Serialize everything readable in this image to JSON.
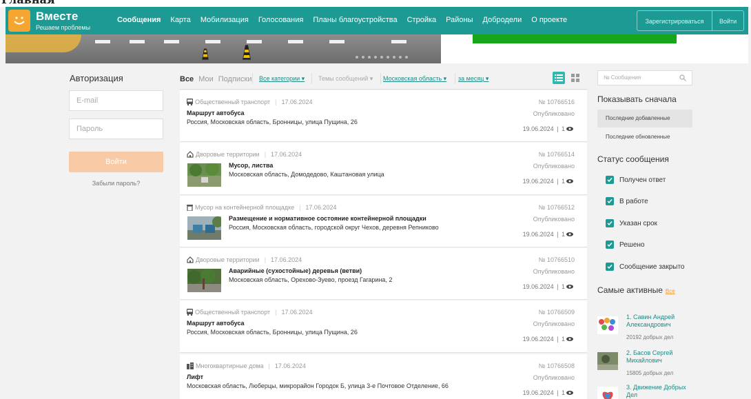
{
  "top_crop_text": "Главная",
  "header": {
    "brand": "Вместе",
    "tagline": "Решаем проблемы",
    "nav": [
      "Сообщения",
      "Карта",
      "Мобилизация",
      "Голосования",
      "Планы благоустройства",
      "Стройка",
      "Районы",
      "Добродели",
      "О проекте"
    ],
    "register": "Зарегистрироваться",
    "login": "Войти"
  },
  "auth": {
    "title": "Авторизация",
    "email_placeholder": "E-mail",
    "password_placeholder": "Пароль",
    "submit": "Войти",
    "forgot": "Забыли пароль?"
  },
  "feed": {
    "tabs": [
      "Все",
      "Мои",
      "Подписки"
    ],
    "filters": {
      "category": "Все категории",
      "topics": "Темы сообщений",
      "region": "Московская область",
      "period": "за месяц"
    },
    "cards": [
      {
        "category": "Общественный транспорт",
        "date": "17.06.2024",
        "title": "Маршрут автобуса",
        "address": "Россия, Московская область, Бронницы, улица Пущина, 26",
        "number": "№ 10766516",
        "status": "Опубликовано",
        "updated": "19.06.2024",
        "views": "1",
        "icon": "bus-icon",
        "thumb": false
      },
      {
        "category": "Дворовые территории",
        "date": "17.06.2024",
        "title": "Мусор, листва",
        "address": "Московская область, Домодедово, Каштановая улица",
        "number": "№ 10766514",
        "status": "Опубликовано",
        "updated": "19.06.2024",
        "views": "1",
        "icon": "house-icon",
        "thumb": true
      },
      {
        "category": "Мусор на контейнерной площадке",
        "date": "17.06.2024",
        "title": "Размещение и нормативное состояние контейнерной площадки",
        "address": "Россия, Московская область, городской округ Чехов, деревня Репниково",
        "number": "№ 10766512",
        "status": "Опубликовано",
        "updated": "19.06.2024",
        "views": "1",
        "icon": "trash-icon",
        "thumb": true
      },
      {
        "category": "Дворовые территории",
        "date": "17.06.2024",
        "title": "Аварийные (сухостойные) деревья (ветви)",
        "address": "Московская область, Орехово-Зуево, проезд Гагарина, 2",
        "number": "№ 10766510",
        "status": "Опубликовано",
        "updated": "19.06.2024",
        "views": "1",
        "icon": "house-icon",
        "thumb": true
      },
      {
        "category": "Общественный транспорт",
        "date": "17.06.2024",
        "title": "Маршрут автобуса",
        "address": "Россия, Московская область, Бронницы, улица Пущина, 26",
        "number": "№ 10766509",
        "status": "Опубликовано",
        "updated": "19.06.2024",
        "views": "1",
        "icon": "bus-icon",
        "thumb": false
      },
      {
        "category": "Многоквартирные дома",
        "date": "17.06.2024",
        "title": "Лифт",
        "address": "Московская область, Люберцы, микрорайон Городок Б, улица 3-е Почтовое Отделение, 66",
        "number": "№ 10766508",
        "status": "Опубликовано",
        "updated": "19.06.2024",
        "views": "1",
        "icon": "building-icon",
        "thumb": false
      }
    ]
  },
  "sidebar": {
    "search_placeholder": "№ Сообщения",
    "sort_title": "Показывать сначала",
    "sort_options": [
      "Последние добавленные",
      "Последние обновленные"
    ],
    "status_title": "Статус сообщения",
    "statuses": [
      "Получен ответ",
      "В работе",
      "Указан срок",
      "Решено",
      "Сообщение закрыто"
    ],
    "active_title": "Самые активные",
    "active_all": "Все",
    "active_users": [
      {
        "name": "1. Савин Андрей Александрович",
        "count": "20192 добрых дел"
      },
      {
        "name": "2. Басов Сергей Михайлович",
        "count": "15805 добрых дел"
      },
      {
        "name": "3. Движение Добрых Дел",
        "count": ""
      }
    ]
  },
  "colors": {
    "teal": "#1d9a93",
    "orange": "#f7a531",
    "login_button": "#f8cba6"
  }
}
